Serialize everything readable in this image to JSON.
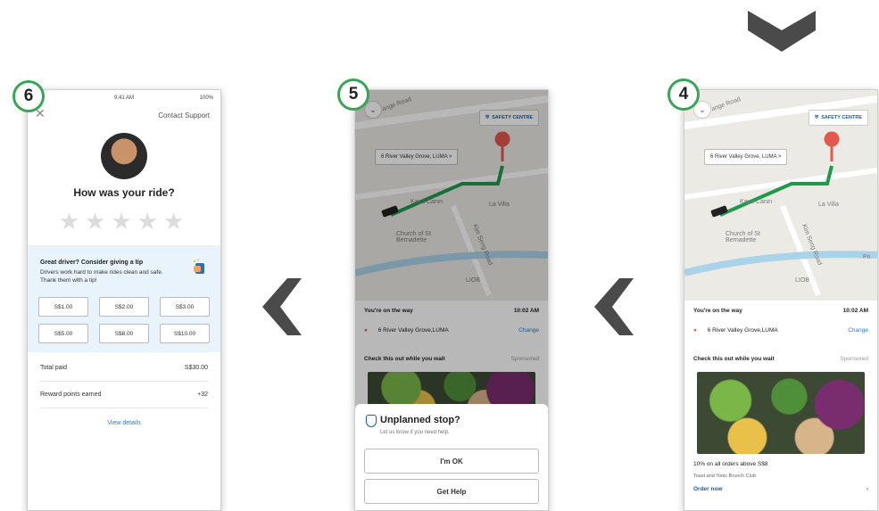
{
  "chevron_down_icon": "chevron-down",
  "screens": {
    "s6": {
      "step": "6",
      "status_time": "9:41 AM",
      "status_battery": "100%",
      "close": "✕",
      "contact_support": "Contact Support",
      "title": "How was your ride?",
      "stars": "★★★★★",
      "tip_heading": "Great driver? Consider giving a tip",
      "tip_text": "Drivers work hard to make rides clean and safe. Thank them with a tip!",
      "tips": [
        "S$1.00",
        "S$2.00",
        "S$3.00",
        "S$5.00",
        "S$8.00",
        "S$10.00"
      ],
      "total_paid_label": "Total paid",
      "total_paid_value": "S$30.00",
      "reward_label": "Reward points earned",
      "reward_value": "+32",
      "view_details": "View details"
    },
    "s5": {
      "step": "5",
      "status_time": "9:06",
      "status_battery": "100%",
      "safety_centre": "SAFETY CENTRE",
      "dest_chip": "6 River Valley Grove, LUMA  >",
      "map_labels": [
        "Grange Road",
        "La Villa",
        "Church of St Bernadette",
        "Kim Seng Road",
        "Alexandra Canal",
        "LIOB",
        "Kaya Canin"
      ],
      "on_way": "You're on the way",
      "time": "10:02 AM",
      "address": "6 River Valley Grove,LUMA",
      "change": "Change",
      "check_out": "Check this out while you wait",
      "sponsored": "Sponsored",
      "sheet_title": "Unplanned stop?",
      "sheet_sub": "Let us know if you need help.",
      "btn_ok": "I'm OK",
      "btn_help": "Get Help"
    },
    "s4": {
      "step": "4",
      "status_time": "9:06",
      "status_battery": "100%",
      "safety_centre": "SAFETY CENTRE",
      "dest_chip": "6 River Valley Grove, LUMA  >",
      "map_labels": [
        "Grange Road",
        "La Villa",
        "Church of St Bernadette",
        "Kim Seng Road",
        "Alexandra Canal",
        "LIOB",
        "Kaya Canin",
        "Pri"
      ],
      "on_way": "You're on the way",
      "time": "10:02 AM",
      "address": "6 River Valley Grove,LUMA",
      "change": "Change",
      "check_out": "Check this out while you wait",
      "sponsored": "Sponsored",
      "promo": "10% on all orders above S$8",
      "promo_sub": "Toast and Tonic Brunch Club",
      "order_now": "Order now",
      "order_arrow": "›"
    }
  },
  "arrows": {
    "left": "❮"
  },
  "colors": {
    "route": "#1f9a4d",
    "pin": "#e2584c",
    "badge": "#3aa655",
    "link": "#2a7bd6"
  }
}
